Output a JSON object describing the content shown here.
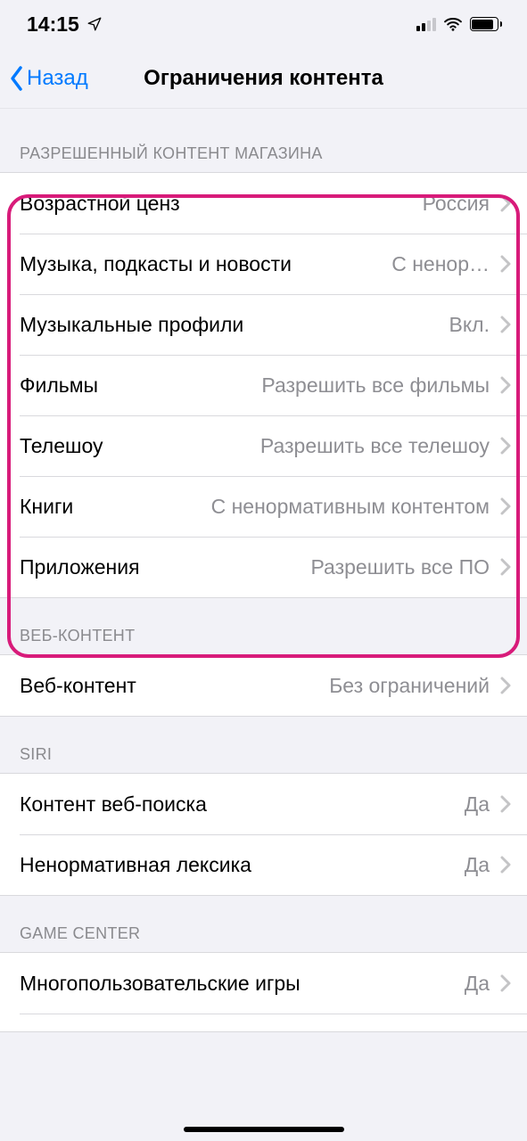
{
  "status": {
    "time": "14:15"
  },
  "nav": {
    "back": "Назад",
    "title": "Ограничения контента"
  },
  "sections": {
    "store": {
      "header": "РАЗРЕШЕННЫЙ КОНТЕНТ МАГАЗИНА"
    },
    "web": {
      "header": "ВЕБ-КОНТЕНТ"
    },
    "siri": {
      "header": "SIRI"
    },
    "gc": {
      "header": "GAME CENTER"
    }
  },
  "store_rows": {
    "ratings": {
      "label": "Возрастной ценз",
      "value": "Россия"
    },
    "music": {
      "label": "Музыка, подкасты и новости",
      "value": "С ненор…"
    },
    "profiles": {
      "label": "Музыкальные профили",
      "value": "Вкл."
    },
    "movies": {
      "label": "Фильмы",
      "value": "Разрешить все фильмы"
    },
    "tv": {
      "label": "Телешоу",
      "value": "Разрешить все телешоу"
    },
    "books": {
      "label": "Книги",
      "value": "С ненормативным контентом"
    },
    "apps": {
      "label": "Приложения",
      "value": "Разрешить все ПО"
    }
  },
  "web_rows": {
    "web": {
      "label": "Веб-контент",
      "value": "Без ограничений"
    }
  },
  "siri_rows": {
    "search": {
      "label": "Контент веб-поиска",
      "value": "Да"
    },
    "explicit": {
      "label": "Ненормативная лексика",
      "value": "Да"
    }
  },
  "gc_rows": {
    "multiplayer": {
      "label": "Многопользовательские игры",
      "value": "Да"
    }
  }
}
